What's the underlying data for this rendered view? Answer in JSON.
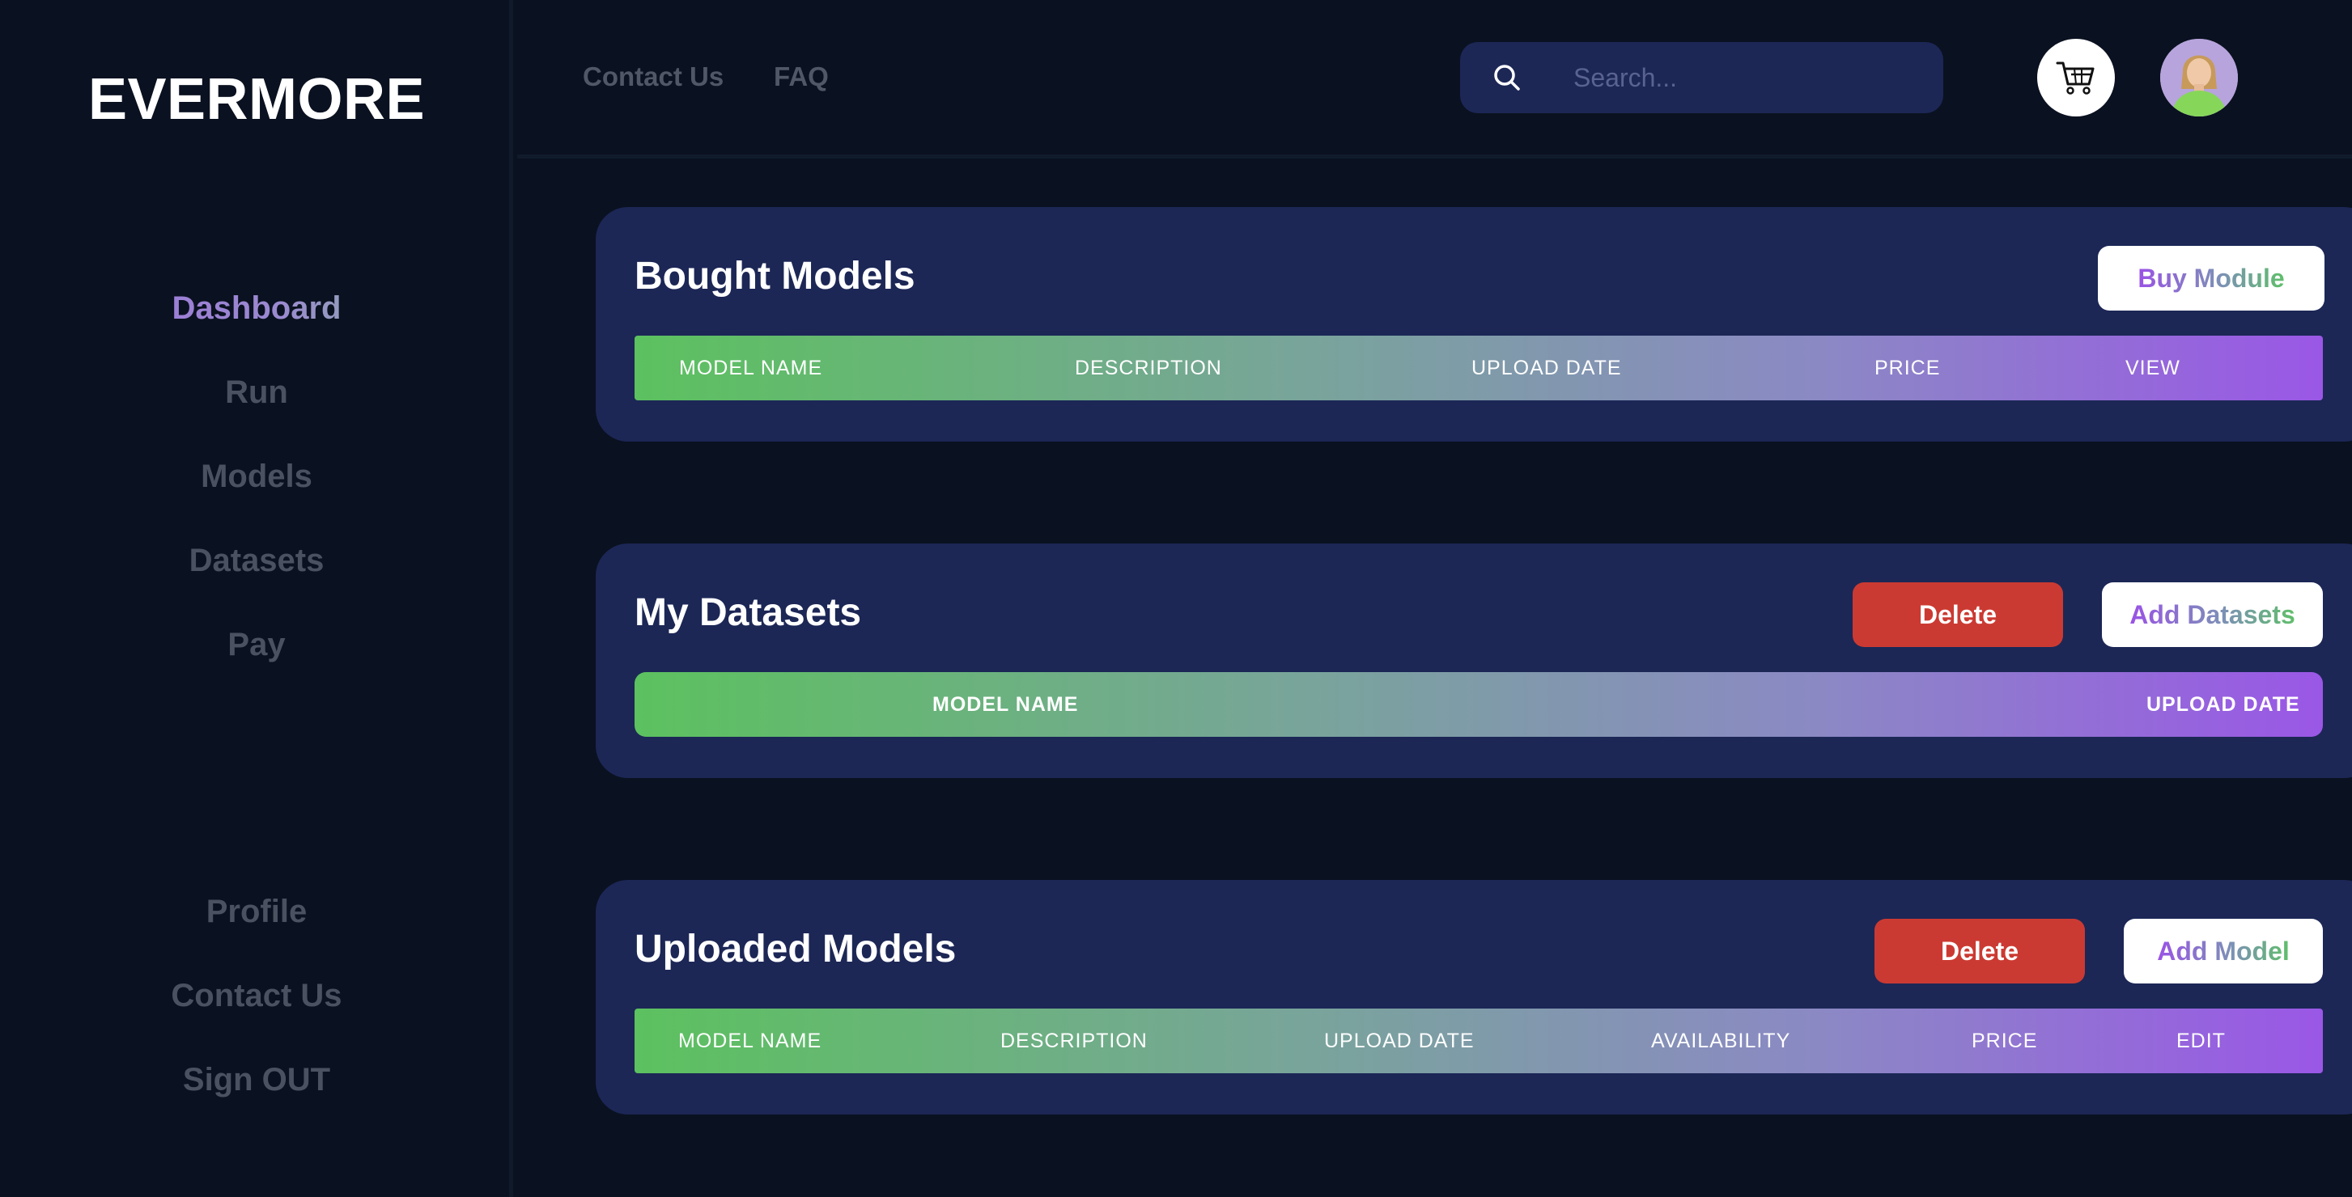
{
  "brand": {
    "logo": "EVERMORE"
  },
  "sidebar": {
    "top_items": [
      {
        "label": "Dashboard",
        "active": true
      },
      {
        "label": "Run"
      },
      {
        "label": "Models"
      },
      {
        "label": "Datasets"
      },
      {
        "label": "Pay"
      }
    ],
    "bottom_items": [
      {
        "label": "Profile"
      },
      {
        "label": "Contact Us"
      },
      {
        "label": "Sign OUT"
      }
    ]
  },
  "header": {
    "links": [
      "Contact Us",
      "FAQ"
    ],
    "search": {
      "placeholder": "Search...",
      "value": ""
    },
    "icons": {
      "search": "search-icon",
      "cart": "cart-icon",
      "avatar": "user-avatar"
    }
  },
  "bought_models": {
    "title": "Bought Models",
    "buy_button": "Buy Module",
    "columns": [
      "MODEL NAME",
      "DESCRIPTION",
      "UPLOAD DATE",
      "PRICE",
      "VIEW"
    ]
  },
  "my_datasets": {
    "title": "My Datasets",
    "delete_button": "Delete",
    "add_button": "Add Datasets",
    "columns": [
      "MODEL NAME",
      "UPLOAD DATE"
    ]
  },
  "uploaded_models": {
    "title": "Uploaded Models",
    "delete_button": "Delete",
    "add_button": "Add Model",
    "columns": [
      "MODEL NAME",
      "DESCRIPTION",
      "UPLOAD DATE",
      "AVAILABILITY",
      "PRICE",
      "EDIT"
    ]
  },
  "colors": {
    "background": "#0a1120",
    "card": "#1c2756",
    "danger": "#cb3a32",
    "gradient_start": "#5cc15f",
    "gradient_end": "#9a57e6",
    "muted_text": "#4a5160"
  }
}
